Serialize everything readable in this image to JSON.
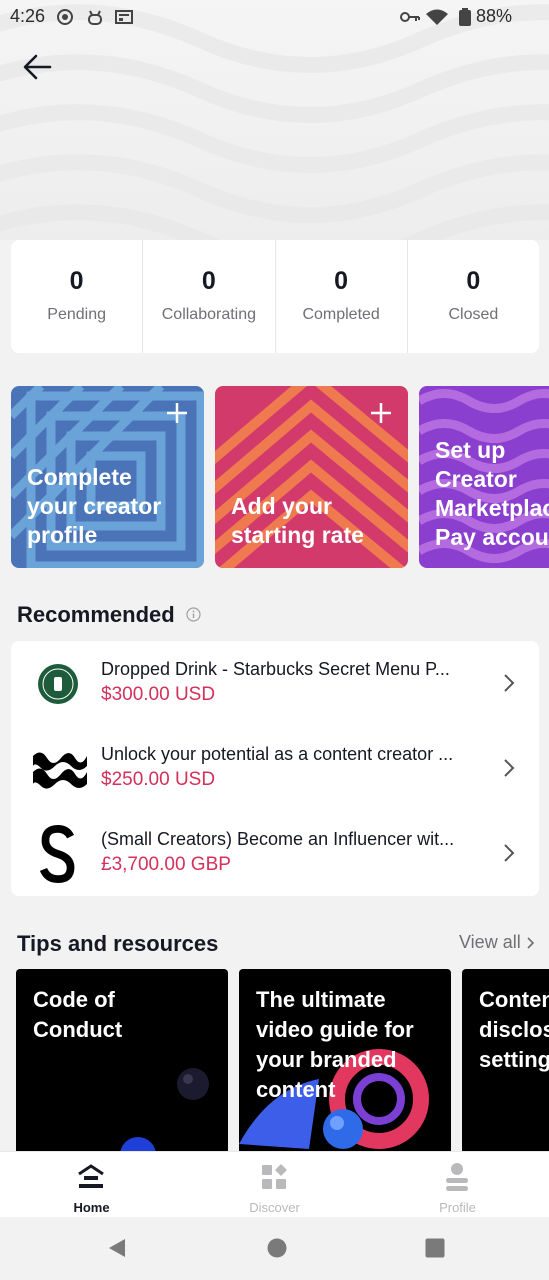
{
  "status_bar": {
    "time": "4:26",
    "battery": "88%",
    "icons": [
      "radio-icon",
      "robot-icon",
      "news-icon",
      "key-icon",
      "wifi-icon",
      "battery-icon"
    ]
  },
  "header": {
    "back_icon": "arrow-left-icon"
  },
  "stats": [
    {
      "value": "0",
      "label": "Pending"
    },
    {
      "value": "0",
      "label": "Collaborating"
    },
    {
      "value": "0",
      "label": "Completed"
    },
    {
      "value": "0",
      "label": "Closed"
    }
  ],
  "action_cards": [
    {
      "title": "Complete\nyour creator\nprofile",
      "color": "#4a73b8",
      "has_plus": true
    },
    {
      "title": "Add your\nstarting rate",
      "color": "#d23a6c",
      "has_plus": true
    },
    {
      "title": "Set up\nCreator\nMarketplace\nPay account",
      "color": "#8a3fcf",
      "has_plus": false
    }
  ],
  "recommended": {
    "title": "Recommended",
    "info_icon": "info-icon",
    "items": [
      {
        "title": "Dropped Drink - Starbucks Secret Menu P...",
        "price": "$300.00 USD",
        "logo": "starbucks-logo"
      },
      {
        "title": "Unlock your potential as a content creator ...",
        "price": "$250.00 USD",
        "logo": "wave-logo"
      },
      {
        "title": "(Small Creators) Become an Influencer wit...",
        "price": "£3,700.00 GBP",
        "logo": "s-logo"
      }
    ]
  },
  "tips": {
    "title": "Tips and resources",
    "view_all": "View all",
    "cards": [
      {
        "title": "Code of\nConduct"
      },
      {
        "title": "The ultimate\nvideo guide for\nyour branded\ncontent"
      },
      {
        "title": "Content\ndisclosure\nsetting"
      }
    ]
  },
  "bottom_nav": [
    {
      "label": "Home",
      "icon": "home-icon",
      "active": true
    },
    {
      "label": "Discover",
      "icon": "discover-icon",
      "active": false
    },
    {
      "label": "Profile",
      "icon": "profile-icon",
      "active": false
    }
  ],
  "system_nav": [
    "back-triangle-icon",
    "home-circle-icon",
    "recents-square-icon"
  ],
  "colors": {
    "price": "#d3305a",
    "text_primary": "#161823",
    "text_secondary": "#6f7075"
  }
}
